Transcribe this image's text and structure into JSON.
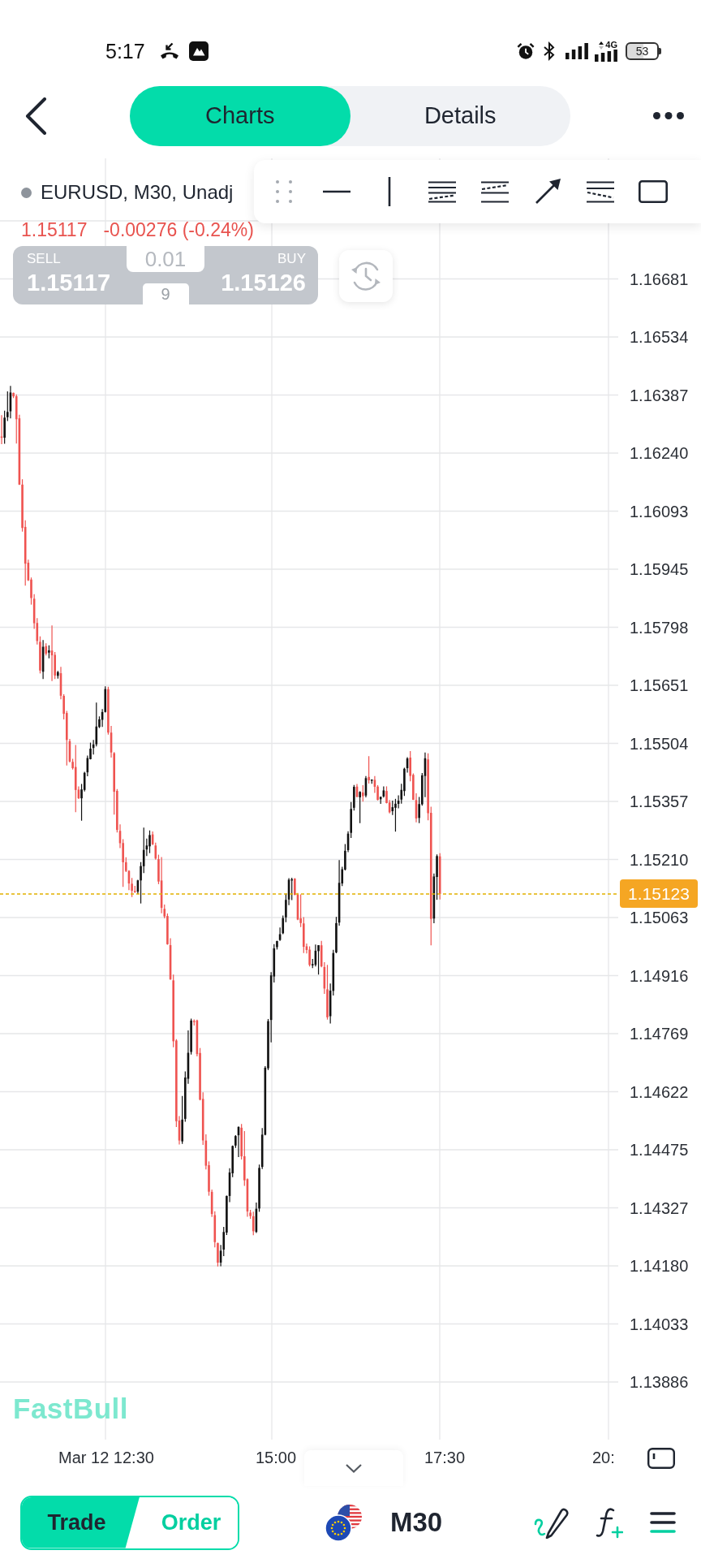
{
  "status_bar": {
    "time": "5:17",
    "network": "4G",
    "battery": "53"
  },
  "header": {
    "tabs": [
      {
        "label": "Charts",
        "selected": true
      },
      {
        "label": "Details",
        "selected": false
      }
    ]
  },
  "chart": {
    "symbol": "EURUSD, M30, Unadj",
    "last_price": "1.15117",
    "change": "-0.00276 (-0.24%)",
    "trade_panel": {
      "sell_label": "SELL",
      "sell_price": "1.15117",
      "lot": "0.01",
      "spread": "9",
      "buy_label": "BUY",
      "buy_price": "1.15126"
    },
    "price_axis": [
      "1.16681",
      "1.16534",
      "1.16387",
      "1.16240",
      "1.16093",
      "1.15945",
      "1.15798",
      "1.15651",
      "1.15504",
      "1.15357",
      "1.15210",
      "1.15063",
      "1.14916",
      "1.14769",
      "1.14622",
      "1.14475",
      "1.14327",
      "1.14180",
      "1.14033",
      "1.13886"
    ],
    "current_price": "1.15123",
    "time_axis": [
      "Mar 12 12:30",
      "15:00",
      "17:30",
      "20:"
    ],
    "logo_text": "FastBull"
  },
  "bottom_bar": {
    "mode_tabs": [
      {
        "label": "Trade",
        "selected": true
      },
      {
        "label": "Order",
        "selected": false
      }
    ],
    "timeframe": "M30"
  }
}
